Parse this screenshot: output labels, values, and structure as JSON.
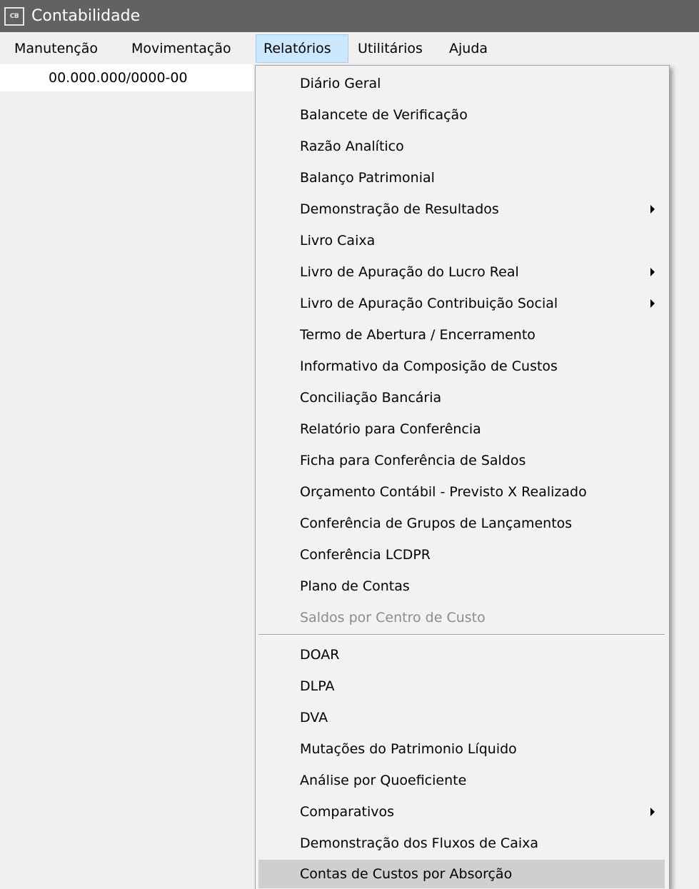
{
  "window": {
    "title": "Contabilidade",
    "icon_label": "CB",
    "icon": "app-logo-icon"
  },
  "menubar": {
    "items": [
      {
        "label": "Manutenção"
      },
      {
        "label": "Movimentação"
      },
      {
        "label": "Relatórios"
      },
      {
        "label": "Utilitários"
      },
      {
        "label": "Ajuda"
      }
    ],
    "active_index": 2
  },
  "company": {
    "cnpj": "00.000.000/0000-00"
  },
  "dropdown": {
    "items": [
      {
        "label": "Diário Geral"
      },
      {
        "label": "Balancete de Verificação"
      },
      {
        "label": "Razão Analítico"
      },
      {
        "label": "Balanço Patrimonial"
      },
      {
        "label": "Demonstração de Resultados",
        "submenu": true
      },
      {
        "label": "Livro Caixa"
      },
      {
        "label": "Livro de Apuração do Lucro Real",
        "submenu": true
      },
      {
        "label": "Livro de Apuração Contribuição Social",
        "submenu": true
      },
      {
        "label": "Termo de Abertura / Encerramento"
      },
      {
        "label": "Informativo da Composição de Custos"
      },
      {
        "label": "Conciliação Bancária"
      },
      {
        "label": "Relatório para Conferência"
      },
      {
        "label": "Ficha para Conferência de Saldos"
      },
      {
        "label": "Orçamento Contábil - Previsto X Realizado"
      },
      {
        "label": "Conferência de Grupos de Lançamentos"
      },
      {
        "label": "Conferência LCDPR"
      },
      {
        "label": "Plano de Contas"
      },
      {
        "label": "Saldos por Centro de Custo",
        "disabled": true
      },
      {
        "label": "DOAR"
      },
      {
        "label": "DLPA"
      },
      {
        "label": "DVA"
      },
      {
        "label": "Mutações do Patrimonio Líquido"
      },
      {
        "label": "Análise por Quoeficiente"
      },
      {
        "label": "Comparativos",
        "submenu": true
      },
      {
        "label": "Demonstração dos Fluxos de Caixa"
      },
      {
        "label": "Contas de Custos por Absorção",
        "highlighted": true
      }
    ]
  },
  "colors": {
    "titlebar": "#626262",
    "menu_active_bg": "#cce8ff",
    "menu_active_border": "#99d1ff",
    "dropdown_bg": "#f2f2f2",
    "highlight_bg": "#cfcfcf",
    "disabled_text": "#8c8c8c"
  }
}
